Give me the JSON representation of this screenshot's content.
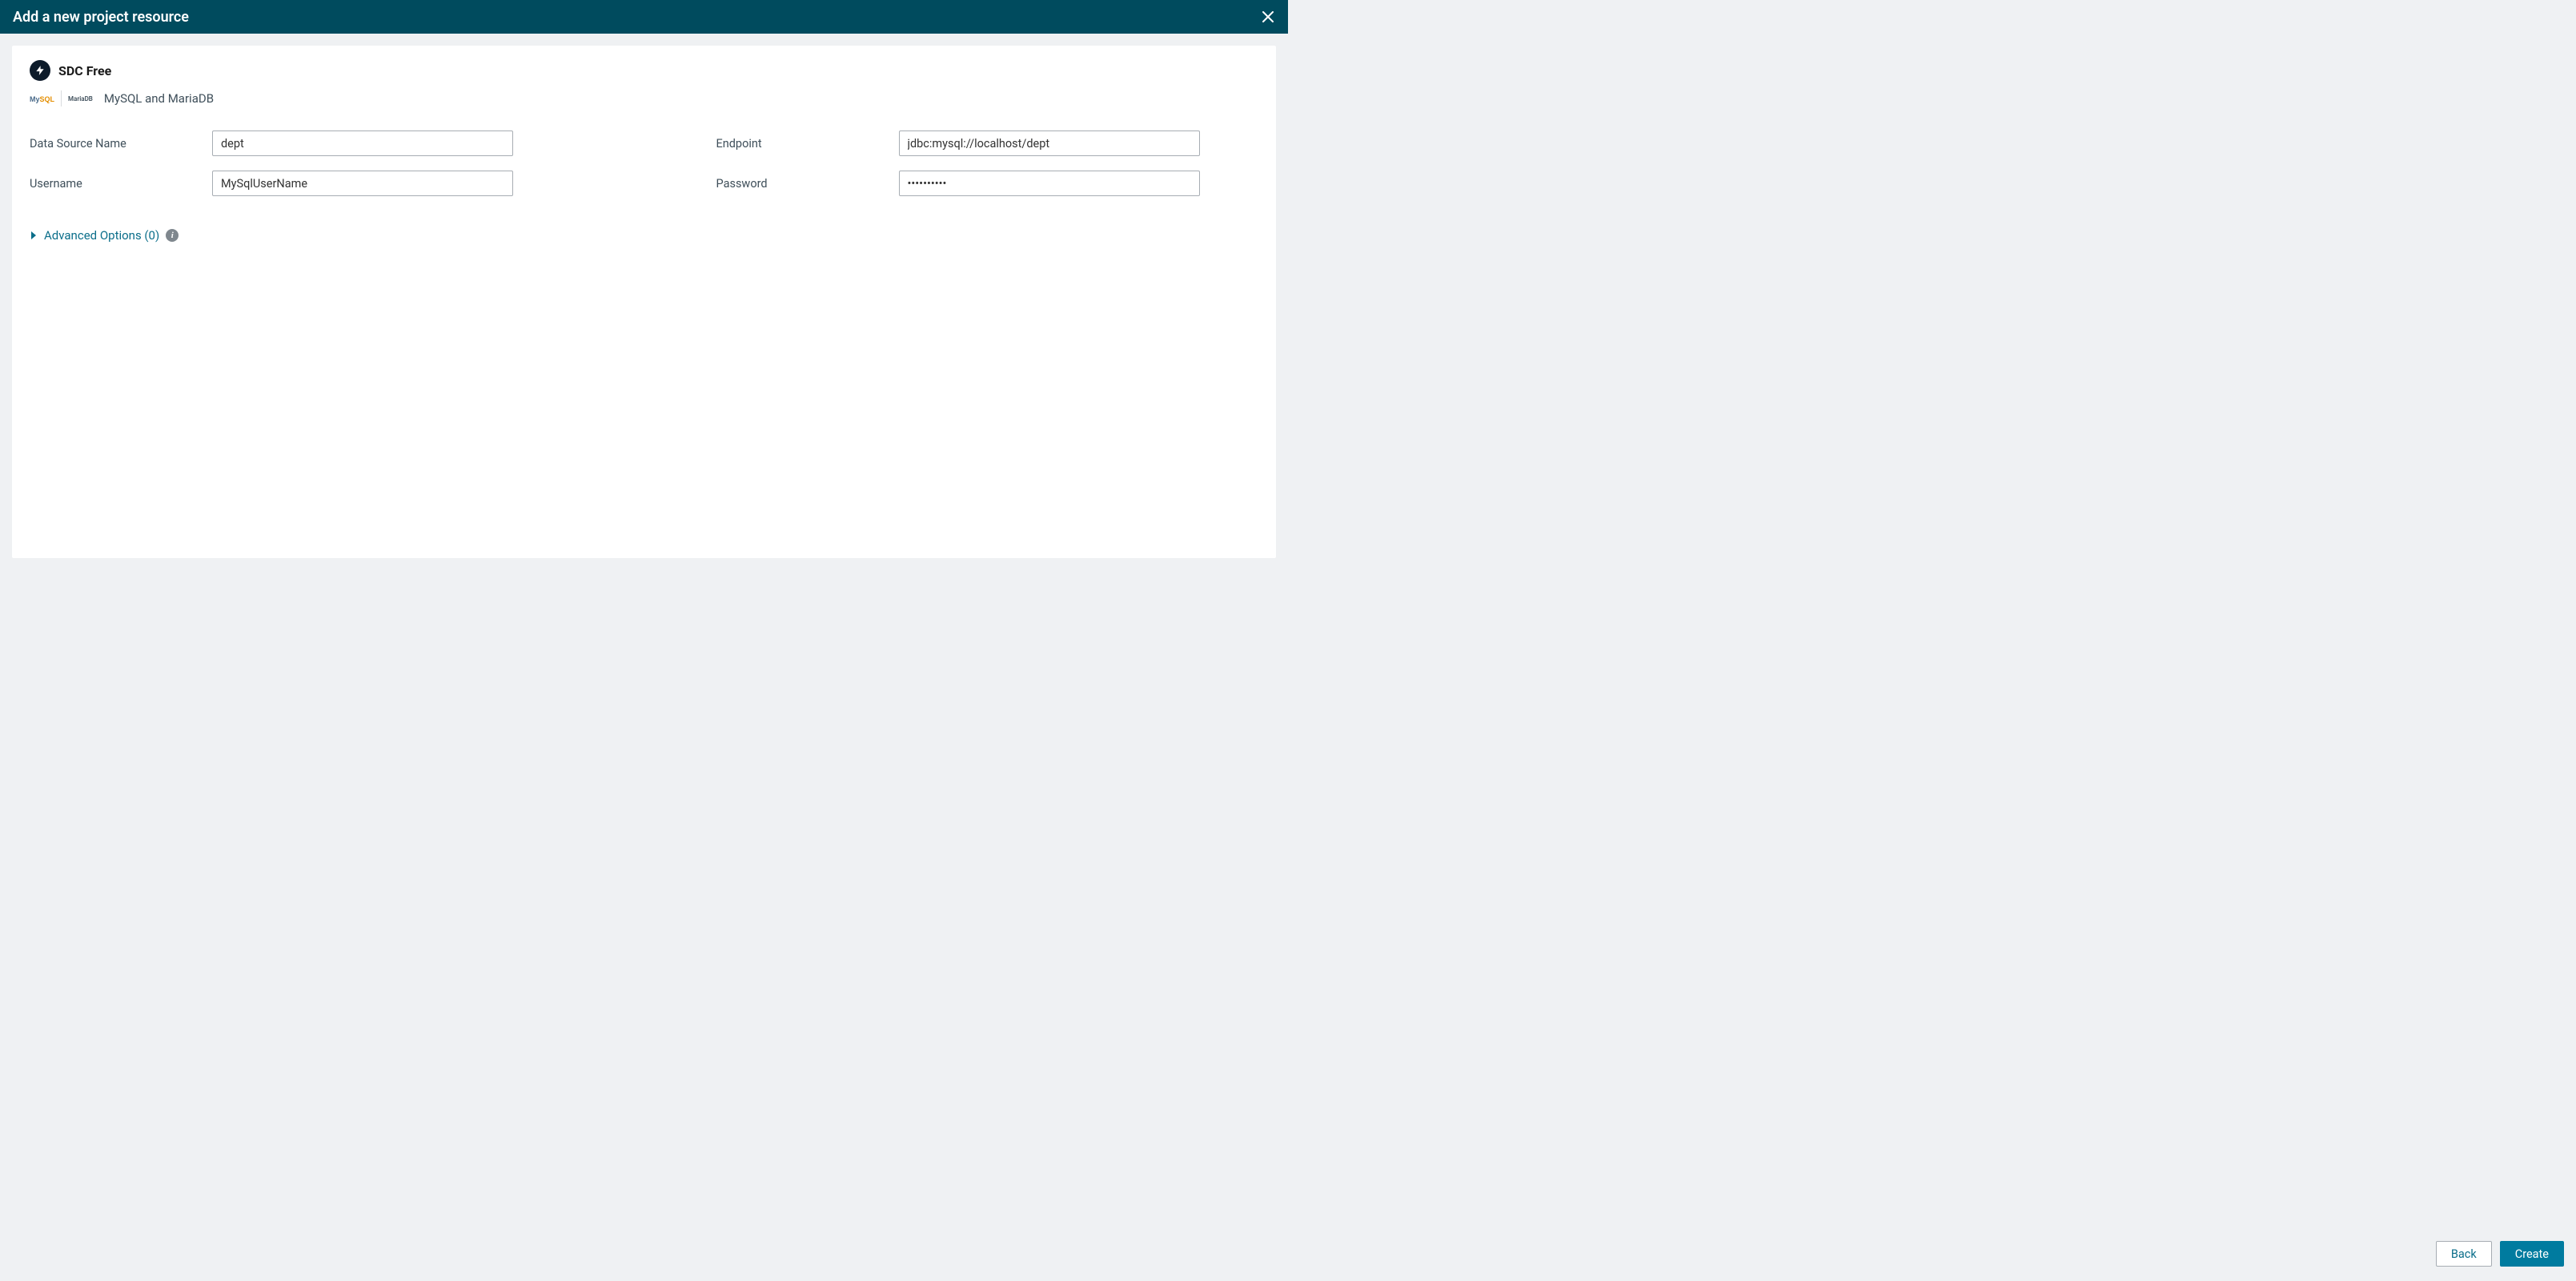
{
  "header": {
    "title": "Add a new project resource"
  },
  "product": {
    "name": "SDC Free",
    "db_label": "MySQL and MariaDB",
    "logo_mysql_my": "My",
    "logo_mysql_sql": "SQL",
    "logo_mariadb": "MariaDB"
  },
  "form": {
    "data_source_name": {
      "label": "Data Source Name",
      "value": "dept"
    },
    "endpoint": {
      "label": "Endpoint",
      "value": "jdbc:mysql://localhost/dept"
    },
    "username": {
      "label": "Username",
      "value": "MySqlUserName"
    },
    "password": {
      "label": "Password",
      "value": "••••••••••"
    }
  },
  "advanced": {
    "label": "Advanced Options (0)"
  },
  "footer": {
    "back": "Back",
    "create": "Create"
  }
}
